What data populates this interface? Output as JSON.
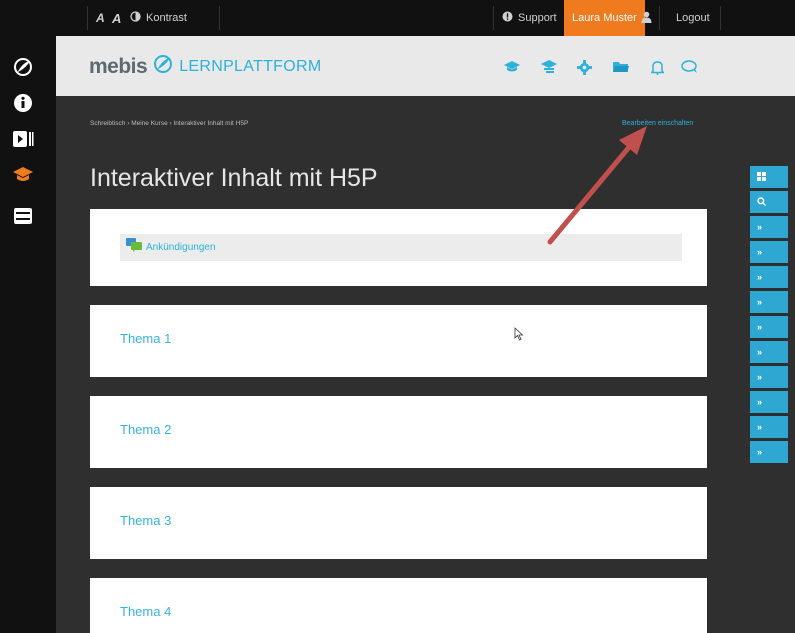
{
  "topbar": {
    "font_smaller": "A",
    "font_larger": "A",
    "contrast_label": "Kontrast",
    "support_label": "Support",
    "user_name": "Laura Muster",
    "logout_label": "Logout"
  },
  "brand": {
    "name": "mebis",
    "product": "LERNPLATTFORM"
  },
  "nav_icons": [
    "graduation-cap-icon",
    "student-cap-icon",
    "gear-icon",
    "folder-icon",
    "bell-icon",
    "chat-icon"
  ],
  "leftbar_icons": [
    "mebis-logo-icon",
    "info-icon",
    "media-play-icon",
    "graduation-cap-icon",
    "drawer-icon"
  ],
  "breadcrumb": {
    "items": [
      "Schreibtisch",
      "Meine Kurse",
      "Interaktiver Inhalt mit H5P"
    ],
    "separator": "›"
  },
  "edit_toggle_label": "Bearbeiten einschalten",
  "page_title": "Interaktiver Inhalt mit H5P",
  "announcements_label": "Ankündigungen",
  "topics": [
    "Thema 1",
    "Thema 2",
    "Thema 3",
    "Thema 4"
  ],
  "right_drawer": {
    "count_chevrons": 10
  },
  "colors": {
    "accent_orange": "#f07a1e",
    "accent_blue": "#2db1db",
    "annotation_arrow": "#c0504d"
  }
}
